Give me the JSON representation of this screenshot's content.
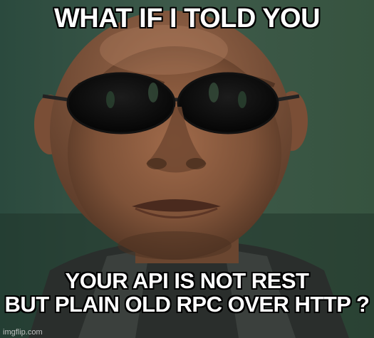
{
  "meme": {
    "top_text": "WHAT IF I TOLD YOU",
    "bottom_text_line1": "YOUR API IS NOT REST",
    "bottom_text_line2": "BUT PLAIN OLD RPC OVER HTTP ?",
    "watermark": "imgflip.com",
    "image": "man-in-dark-sunglasses-photo"
  },
  "colors": {
    "caption_fill": "#ffffff",
    "caption_outline": "#000000",
    "background": "#2a4b3d",
    "skin": "#8a5b40",
    "lens": "#0a0a0a"
  }
}
